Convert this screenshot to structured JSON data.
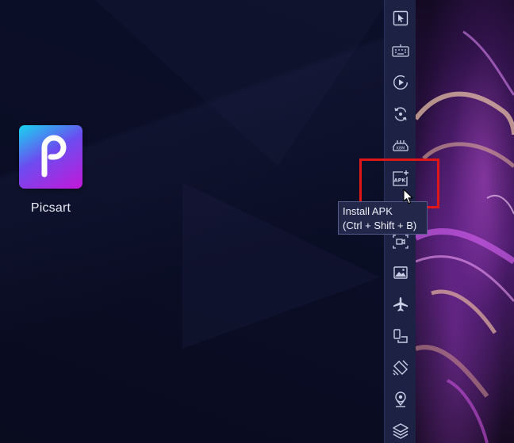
{
  "desktop": {
    "apps": [
      {
        "label": "Picsart",
        "icon": "picsart-p-icon"
      }
    ]
  },
  "toolbar": {
    "buttons": [
      {
        "name": "select-tool",
        "icon": "cursor-arrow-icon"
      },
      {
        "name": "keyboard-controls",
        "icon": "keyboard-icon"
      },
      {
        "name": "macro-recorder",
        "icon": "play-circle-icon"
      },
      {
        "name": "rotate-screen",
        "icon": "rotate-icon"
      },
      {
        "name": "performance-mode",
        "icon": "car-gamepad-icon"
      },
      {
        "name": "install-apk",
        "icon": "apk-install-icon",
        "label": "APK"
      },
      {
        "name": "screen-record",
        "icon": "screen-record-icon"
      },
      {
        "name": "media-folder",
        "icon": "image-folder-icon"
      },
      {
        "name": "airplane-mode",
        "icon": "airplane-icon"
      },
      {
        "name": "multi-instance",
        "icon": "multi-window-icon"
      },
      {
        "name": "shake",
        "icon": "shake-icon"
      },
      {
        "name": "location",
        "icon": "location-pin-icon"
      },
      {
        "name": "layers",
        "icon": "layers-icon"
      }
    ]
  },
  "tooltip": {
    "line1": "Install APK",
    "line2": "(Ctrl + Shift + B)"
  },
  "colors": {
    "desktop_bg": "#0b0e24",
    "toolbar_bg": "#1d2244",
    "highlight": "#e11717",
    "tooltip_bg": "#23284a"
  }
}
